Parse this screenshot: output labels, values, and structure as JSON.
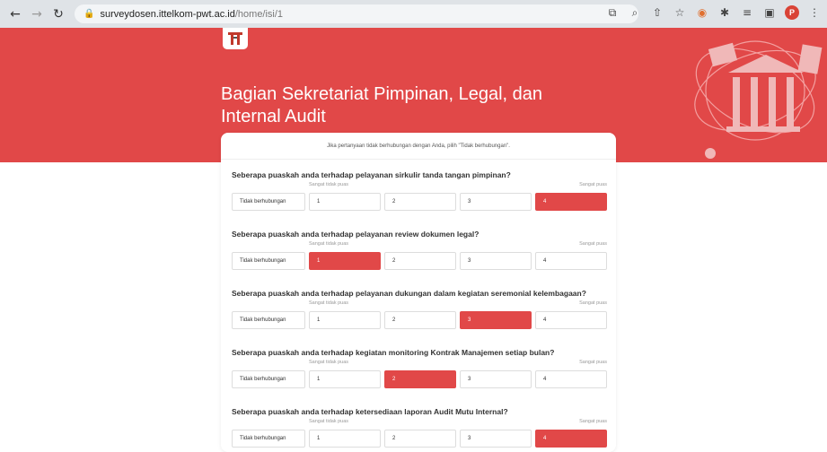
{
  "browser": {
    "url_host": "surveydosen.ittelkom-pwt.ac.id",
    "url_path": "/home/isi/1",
    "avatar_letter": "P"
  },
  "header": {
    "title": "Bagian Sekretariat Pimpinan, Legal, dan Internal Audit"
  },
  "notice": "Jika pertanyaan tidak berhubungan dengan Anda, pilih \"Tidak berhubungan\".",
  "scale": {
    "min_label": "Sangat tidak puas",
    "max_label": "Sangat puas",
    "na_label": "Tidak berhubungan"
  },
  "questions": [
    {
      "text": "Seberapa puaskah anda terhadap pelayanan sirkulir tanda tangan pimpinan?",
      "options": [
        "1",
        "2",
        "3",
        "4"
      ],
      "selected": "4"
    },
    {
      "text": "Seberapa puaskah anda terhadap pelayanan review dokumen legal?",
      "options": [
        "1",
        "2",
        "3",
        "4"
      ],
      "selected": "1"
    },
    {
      "text": "Seberapa puaskah anda terhadap pelayanan dukungan dalam kegiatan seremonial kelembagaan?",
      "options": [
        "1",
        "2",
        "3",
        "4"
      ],
      "selected": "3"
    },
    {
      "text": "Seberapa puaskah anda terhadap kegiatan monitoring Kontrak Manajemen setiap bulan?",
      "options": [
        "1",
        "2",
        "3",
        "4"
      ],
      "selected": "2"
    },
    {
      "text": "Seberapa puaskah anda terhadap ketersediaan laporan Audit Mutu Internal?",
      "options": [
        "1",
        "2",
        "3",
        "4"
      ],
      "selected": "4"
    }
  ],
  "colors": {
    "accent": "#e14848",
    "chrome": "#dfe3e7"
  }
}
